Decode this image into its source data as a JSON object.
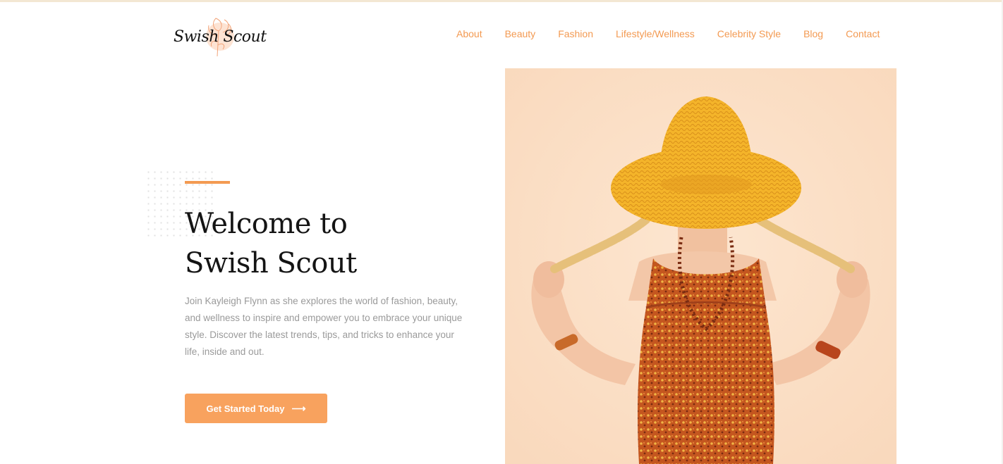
{
  "brand": {
    "logo_text": "Swish Scout"
  },
  "nav": {
    "items": [
      {
        "label": "About"
      },
      {
        "label": "Beauty"
      },
      {
        "label": "Fashion"
      },
      {
        "label": "Lifestyle/Wellness"
      },
      {
        "label": "Celebrity Style"
      },
      {
        "label": "Blog"
      },
      {
        "label": "Contact"
      }
    ]
  },
  "hero": {
    "title_line1": "Welcome to",
    "title_line2": "Swish Scout",
    "description": "Join Kayleigh Flynn as she explores the world of fashion, beauty, and wellness to inspire and empower you to embrace your unique style. Discover the latest trends, tips, and tricks to enhance your life, inside and out.",
    "cta_label": "Get Started Today",
    "cta_icon": "arrow-right-icon"
  },
  "colors": {
    "accent": "#f39a52",
    "button": "#f8a25e",
    "heading": "#141414",
    "body_text": "#9a9a9a",
    "image_background": "#fbe0c7"
  }
}
